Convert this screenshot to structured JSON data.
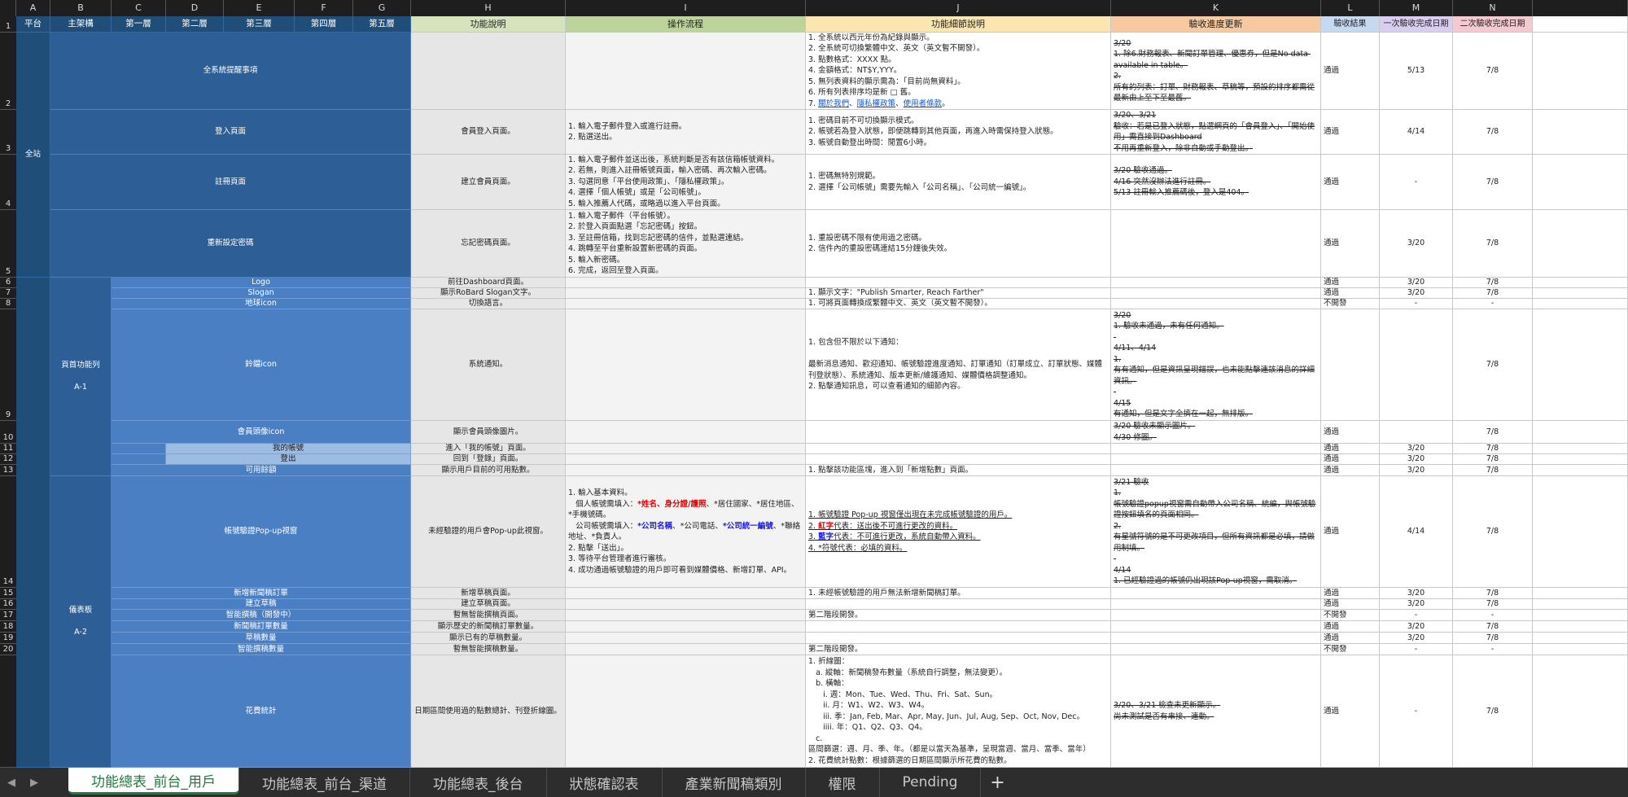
{
  "columns": [
    {
      "letter": "A"
    },
    {
      "letter": "B"
    },
    {
      "letter": "C"
    },
    {
      "letter": "D"
    },
    {
      "letter": "E"
    },
    {
      "letter": "F"
    },
    {
      "letter": "G"
    },
    {
      "letter": "H"
    },
    {
      "letter": "I"
    },
    {
      "letter": "J"
    },
    {
      "letter": "K"
    },
    {
      "letter": "L"
    },
    {
      "letter": "M"
    },
    {
      "letter": "N"
    },
    {
      "letter": ""
    }
  ],
  "headers": {
    "platform": "平台",
    "main": "主架構",
    "l1": "第一層",
    "l2": "第二層",
    "l3": "第三層",
    "l4": "第四層",
    "l5": "第五層",
    "func": "功能說明",
    "flow": "操作流程",
    "detail": "功能細節說明",
    "progress": "驗收進度更新",
    "result": "驗收結果",
    "first": "一次驗收完成日期",
    "second": "二次驗收完成日期"
  },
  "groups": {
    "platform": "全站",
    "a1_l1": "頁首功能列",
    "a1_l2": "A-1",
    "a2_l1": "儀表板",
    "a2_l2": "A-2"
  },
  "rows": [
    {
      "n": "2",
      "name": "全系統提醒事項",
      "func": "",
      "flow": "",
      "detail": [
        "1. 全系統以西元年份為紀錄與顯示。",
        "2. 全系統可切換繁體中文、英文（英文暫不開發）。",
        "3. 點數格式：XXXX 點。",
        "4. 金額格式：NT$Y,YYY。",
        "5. 無列表資料的顯示需為：「目前尚無資料」。",
        "6. 所有列表排序均是新 □ 舊。"
      ],
      "detail_links": [
        "7. ",
        "關於我們",
        "、",
        "隱私權政策",
        "、",
        "使用者條款",
        "。"
      ],
      "progress": [
        "3/20",
        "1. 除6.財務報表、新聞訂單管理、優惠券，但是No data available in table。",
        "2.",
        "所有的列表：訂單、財務報表、草稿等，預設的排序都需從最新由上至下至最舊。"
      ],
      "result": "通過",
      "first": "5/13",
      "second": "7/8"
    },
    {
      "n": "3",
      "name": "登入頁面",
      "func": "會員登入頁面。",
      "flow": [
        "1. 輸入電子郵件登入或進行註冊。",
        "2. 點選送出。"
      ],
      "detail": [
        "1. 密碼目前不可切換顯示模式。",
        "2. 帳號若為登入狀態，即便跳轉到其他頁面，再進入時需保持登入狀態。",
        "3. 帳號自動登出時間：閒置6小時。"
      ],
      "progress": [
        "3/20、3/21",
        "驗收：若是已登入狀態，點選網頁的「會員登入」、「開始使用」需直接到Dashboard",
        "不用再重新登入，除非自動或手動登出。"
      ],
      "result": "通過",
      "first": "4/14",
      "second": "7/8"
    },
    {
      "n": "4",
      "name": "註冊頁面",
      "func": "建立會員頁面。",
      "flow": [
        "1. 輸入電子郵件並送出後，系統判斷是否有該信箱帳號資料。",
        "2. 若無，則進入註冊帳號頁面，輸入密碼、再次輸入密碼。",
        "3. 勾選同意「平台使用政策」、「隱私權政策」。",
        "4. 選擇「個人帳號」或是「公司帳號」。",
        "5. 輸入推薦人代碼，或略過以進入平台頁面。"
      ],
      "detail": [
        "1. 密碼無特別規範。",
        "2. 選擇「公司帳號」需要先輸入「公司名稱」、「公司統一編號」。"
      ],
      "progress": [
        "3/20 驗收通過。",
        "4/16 突然沒辦法進行註冊。",
        "5/13 註冊輸入推薦碼後，登入是404。"
      ],
      "result": "通過",
      "first": "-",
      "second": "7/8"
    },
    {
      "n": "5",
      "name": "重新設定密碼",
      "func": "忘記密碼頁面。",
      "flow": [
        "1. 輸入電子郵件（平台帳號）。",
        "2. 於登入頁面點選「忘記密碼」按鈕。",
        "3. 至註冊信箱，找到忘記密碼的信件，並點選連結。",
        "4. 跳轉至平台重新設置新密碼的頁面。",
        "5. 輸入新密碼。",
        "6. 完成，返回至登入頁面。"
      ],
      "detail": [
        "1. 重設密碼不限有使用過之密碼。",
        "2. 信件內的重設密碼連結15分鐘後失效。"
      ],
      "progress": [],
      "result": "通過",
      "first": "3/20",
      "second": "7/8"
    },
    {
      "n": "6",
      "name": "Logo",
      "func": "前往Dashboard頁面。",
      "flow": "",
      "detail": [],
      "progress": [],
      "result": "通過",
      "first": "3/20",
      "second": "7/8"
    },
    {
      "n": "7",
      "name": "Slogan",
      "func": "顯示RoBard Slogan文字。",
      "flow": "",
      "detail": [
        "1. 顯示文字：\"Publish Smarter, Reach Farther\""
      ],
      "progress": [],
      "result": "通過",
      "first": "3/20",
      "second": "7/8"
    },
    {
      "n": "8",
      "name": "地球icon",
      "func": "切換語言。",
      "flow": "",
      "detail": [
        "1. 可將頁面轉換成繁體中文、英文（英文暫不開發）。"
      ],
      "progress": [],
      "result": "不開發",
      "first": "-",
      "second": "-"
    },
    {
      "n": "9",
      "name": "鈴鐺icon",
      "func": "系統通知。",
      "flow": "",
      "detail": [
        "1. 包含但不限於以下通知：",
        "",
        "最新消息通知、歡迎通知、帳號驗證進度通知、訂單通知（訂單成立、訂單狀態、媒體刊登狀態）、系統通知、版本更新/維護通知、媒體價格調整通知。",
        "2. 點擊通知訊息，可以查看通知的細節內容。"
      ],
      "progress": [
        "3/20",
        "1. 驗收未通過，未有任何通知。",
        "",
        "4/11、4/14",
        "1.",
        "有有通知，但是資訊呈現錯誤，也未能點擊連該消息的詳細資訊。",
        "",
        "4/15",
        "有通知，但是文字全擠在一起，無排版。"
      ],
      "result": "",
      "first": "",
      "second": "7/8"
    },
    {
      "n": "10",
      "name": "會員頭像icon",
      "func": "顯示會員頭像圖片。",
      "flow": "",
      "detail": [],
      "progress": [
        "3/20 驗收未顯示圖片。",
        "4/30 修圖。"
      ],
      "result": "通過",
      "first": "",
      "second": "7/8"
    },
    {
      "n": "11",
      "name": "我的帳號",
      "func": "進入「我的帳號」頁面。",
      "flow": "",
      "detail": [],
      "progress": [],
      "result": "通過",
      "first": "3/20",
      "second": "7/8"
    },
    {
      "n": "12",
      "name": "登出",
      "func": "回到「登錄」頁面。",
      "flow": "",
      "detail": [],
      "progress": [],
      "result": "通過",
      "first": "3/20",
      "second": "7/8"
    },
    {
      "n": "13",
      "name": "可用餘額",
      "func": "顯示用戶目前的可用點數。",
      "flow": "",
      "detail": [
        "1. 點擊該功能區塊，進入到「新增點數」頁面。"
      ],
      "progress": [],
      "result": "通過",
      "first": "3/20",
      "second": "7/8"
    },
    {
      "n": "14",
      "name": "帳號驗證Pop-up視窗",
      "func": "未經驗證的用戶會Pop-up此視窗。",
      "flow_a": "1. 輸入基本資料。\n   個人帳號需填入：",
      "flow_red": "姓名、身分證/護照",
      "flow_b": "、*居住國家、*居住地區、*手機號碼。\n   公司帳號需填入：",
      "flow_blue1": "公司名稱",
      "flow_c": "、*公司電話、",
      "flow_blue2": "公司統一編號",
      "flow_d": "、*聯絡地址、*負責人。\n2. 點擊「送出」。\n3. 等待平台管理者進行審核。\n4. 成功通過帳號驗證的用戶即可看到媒體價格、新增訂單、API。",
      "detail_a": "1. 帳號驗證 Pop-up 視窗僅出現在未完成帳號驗證的用戶。",
      "detail_r": "紅字",
      "detail_r2": "代表：送出後不可進行更改的資料。",
      "detail_b": "藍字",
      "detail_b2": "代表：不可進行更改，系統自動帶入資料。",
      "detail_s": "4. *符號代表：必填的資料。",
      "progress": [
        "3/21 驗收",
        "1.",
        "帳號驗證popup視窗需自動帶入公司名稱、統編，與帳號驗證按鈕填名的頁面相同。",
        "2.",
        "有星號符號的是不可更改項目，但所有資訊都是必填，請做用制填。",
        "",
        "4/14",
        "1. 已經驗證過的帳號仍出現該Pop-up視窗，需取消。"
      ],
      "result": "通過",
      "first": "4/14",
      "second": "7/8"
    },
    {
      "n": "15",
      "name": "新增新聞稿訂單",
      "func": "新增草稿頁面。",
      "flow": "",
      "detail": [
        "1. 未經帳號驗證的用戶無法新增新聞稿訂單。"
      ],
      "progress": [],
      "result": "通過",
      "first": "3/20",
      "second": "7/8"
    },
    {
      "n": "16",
      "name": "建立草稿",
      "func": "建立草稿頁面。",
      "flow": "",
      "detail": [],
      "progress": [],
      "result": "通過",
      "first": "3/20",
      "second": "7/8"
    },
    {
      "n": "17",
      "name": "智能撰稿（開發中）",
      "func": "暫無智能撰稿頁面。",
      "flow": "",
      "detail": [
        "第二階段開發。"
      ],
      "progress": [],
      "result": "不開發",
      "first": "-",
      "second": "-"
    },
    {
      "n": "18",
      "name": "新聞稿訂單數量",
      "func": "顯示歷史的新聞稿訂單數量。",
      "flow": "",
      "detail": [],
      "progress": [],
      "result": "通過",
      "first": "3/20",
      "second": "7/8"
    },
    {
      "n": "19",
      "name": "草稿數量",
      "func": "顯示已有的草稿數量。",
      "flow": "",
      "detail": [],
      "progress": [],
      "result": "通過",
      "first": "3/20",
      "second": "7/8"
    },
    {
      "n": "20",
      "name": "智能撰稿數量",
      "func": "暫無智能撰稿數量。",
      "flow": "",
      "detail": [
        "第二階段開發。"
      ],
      "progress": [],
      "result": "不開發",
      "first": "-",
      "second": "-"
    },
    {
      "n": "",
      "name": "花費統計",
      "func": "日期區間使用過的點數總計、刊登折線圖。",
      "flow": "",
      "detail": [
        "1. 折線圖：",
        "   a. 縱軸：新聞稿發布數量（系統自行調整，無法變更）。",
        "   b. 橫軸：",
        "      i. 週：Mon、Tue、Wed、Thu、Fri、Sat、Sun。",
        "      ii. 月：W1、W2、W3、W4。",
        "      iii. 季：Jan, Feb, Mar、Apr, May, Jun、Jul, Aug, Sep、Oct, Nov, Dec。",
        "      iiii. 年：Q1、Q2、Q3、Q4。",
        "   c.",
        "區間篩選：週、月、季、年。（都是以當天為基準，呈現當週、當月、當季、當年）",
        "2. 花費統計點數：根據篩選的日期區間顯示所花費的點數。"
      ],
      "progress": [
        "3/20、3/21 檢查未更新顯示。",
        "尚未測試是否有串接、連動。"
      ],
      "result": "通過",
      "first": "-",
      "second": "7/8"
    }
  ],
  "tabs": [
    {
      "label": "功能總表_前台_用戶",
      "active": true
    },
    {
      "label": "功能總表_前台_渠道",
      "active": false
    },
    {
      "label": "功能總表_後台",
      "active": false
    },
    {
      "label": "狀態確認表",
      "active": false
    },
    {
      "label": "產業新聞稿類別",
      "active": false
    },
    {
      "label": "權限",
      "active": false
    },
    {
      "label": "Pending",
      "active": false
    }
  ],
  "nav": {
    "prev": "◀",
    "next": "▶",
    "add": "+"
  }
}
